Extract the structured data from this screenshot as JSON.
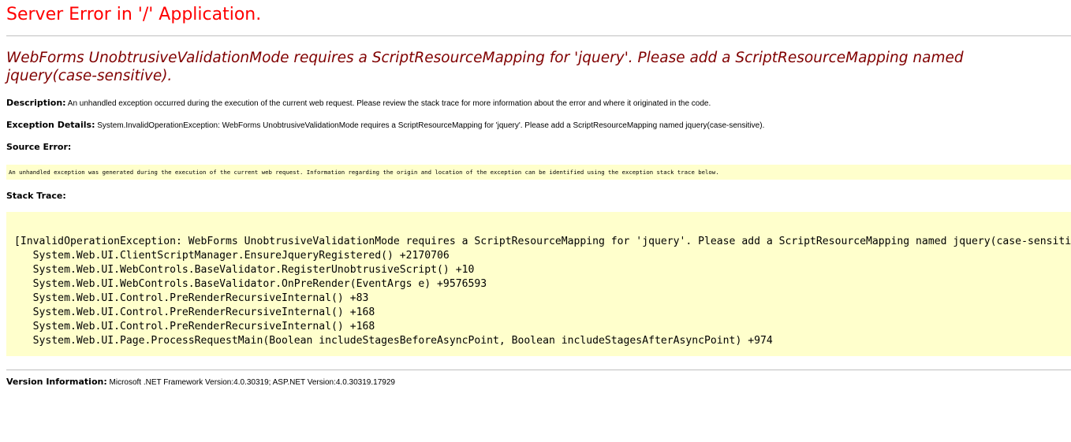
{
  "header": {
    "title": "Server Error in '/' Application."
  },
  "error": {
    "message": "WebForms UnobtrusiveValidationMode requires a ScriptResourceMapping for 'jquery'. Please add a ScriptResourceMapping named jquery(case-sensitive)."
  },
  "description": {
    "label": "Description:",
    "text": "An unhandled exception occurred during the execution of the current web request. Please review the stack trace for more information about the error and where it originated in the code."
  },
  "exception_details": {
    "label": "Exception Details:",
    "text": "System.InvalidOperationException: WebForms UnobtrusiveValidationMode requires a ScriptResourceMapping for 'jquery'. Please add a ScriptResourceMapping named jquery(case-sensitive)."
  },
  "source_error": {
    "label": "Source Error:",
    "text": "An unhandled exception was generated during the execution of the current web request. Information regarding the origin and location of the exception can be identified using the exception stack trace below."
  },
  "stack_trace": {
    "label": "Stack Trace:",
    "lines": [
      "[InvalidOperationException: WebForms UnobtrusiveValidationMode requires a ScriptResourceMapping for 'jquery'. Please add a ScriptResourceMapping named jquery(case-sensitive).]",
      "   System.Web.UI.ClientScriptManager.EnsureJqueryRegistered() +2170706",
      "   System.Web.UI.WebControls.BaseValidator.RegisterUnobtrusiveScript() +10",
      "   System.Web.UI.WebControls.BaseValidator.OnPreRender(EventArgs e) +9576593",
      "   System.Web.UI.Control.PreRenderRecursiveInternal() +83",
      "   System.Web.UI.Control.PreRenderRecursiveInternal() +168",
      "   System.Web.UI.Control.PreRenderRecursiveInternal() +168",
      "   System.Web.UI.Page.ProcessRequestMain(Boolean includeStagesBeforeAsyncPoint, Boolean includeStagesAfterAsyncPoint) +974"
    ]
  },
  "version": {
    "label": "Version Information:",
    "text": "Microsoft .NET Framework Version:4.0.30319; ASP.NET Version:4.0.30319.17929"
  },
  "colors": {
    "title": "#ff0000",
    "message": "#800000",
    "code_background": "#ffffcc",
    "rule": "#c0c0c0"
  }
}
